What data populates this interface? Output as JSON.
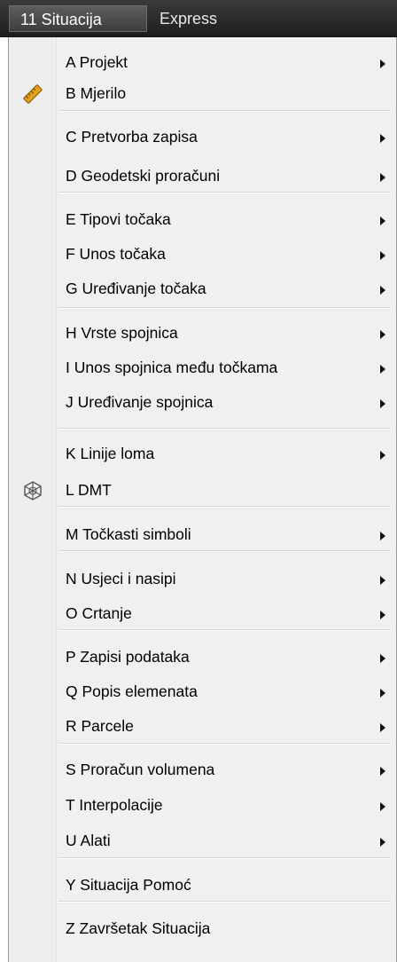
{
  "menubar": {
    "active_tab": "11 Situacija",
    "tab2": "Express"
  },
  "menu": {
    "items": [
      {
        "label": "A Projekt",
        "submenu": true
      },
      {
        "label": "B Mjerilo",
        "submenu": false,
        "icon": "ruler-icon"
      },
      {
        "label": "C Pretvorba zapisa",
        "submenu": true
      },
      {
        "label": "D Geodetski proračuni",
        "submenu": true
      },
      {
        "label": "E Tipovi točaka",
        "submenu": true
      },
      {
        "label": "F Unos točaka",
        "submenu": true
      },
      {
        "label": "G Uređivanje točaka",
        "submenu": true
      },
      {
        "label": "H Vrste spojnica",
        "submenu": true
      },
      {
        "label": "I Unos spojnica među točkama",
        "submenu": true
      },
      {
        "label": "J Uređivanje spojnica",
        "submenu": true
      },
      {
        "label": "K Linije loma",
        "submenu": true
      },
      {
        "label": "L DMT",
        "submenu": false,
        "icon": "terrain-mesh-icon"
      },
      {
        "label": "M Točkasti simboli",
        "submenu": true
      },
      {
        "label": "N Usjeci i nasipi",
        "submenu": true
      },
      {
        "label": "O Crtanje",
        "submenu": true
      },
      {
        "label": "P Zapisi podataka",
        "submenu": true
      },
      {
        "label": "Q Popis elemenata",
        "submenu": true
      },
      {
        "label": "R Parcele",
        "submenu": true
      },
      {
        "label": "S Proračun volumena",
        "submenu": true
      },
      {
        "label": "T Interpolacije",
        "submenu": true
      },
      {
        "label": "U Alati",
        "submenu": true
      },
      {
        "label": "Y Situacija Pomoć",
        "submenu": false
      },
      {
        "label": "Z Završetak Situacija",
        "submenu": false
      }
    ]
  },
  "colors": {
    "menubar_bg": "#2b2b2b",
    "menu_bg": "#f0f0f0",
    "ruler_icon": "#e0a020"
  }
}
